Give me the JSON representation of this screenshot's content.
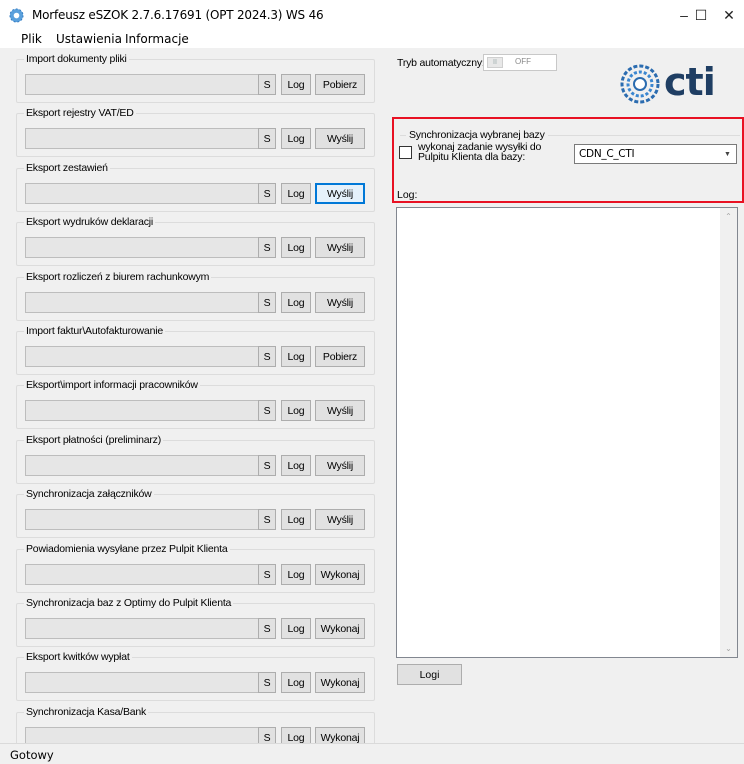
{
  "window": {
    "title": "Morfeusz eSZOK 2.7.6.17691 (OPT 2024.3) WS 46",
    "minimize_glyph": "–",
    "maximize_glyph": "☐",
    "close_glyph": "✕"
  },
  "menu": [
    "Plik",
    "Ustawienia",
    "Informacje"
  ],
  "groups": [
    {
      "title": "Import dokumenty pliki",
      "action": "Pobierz"
    },
    {
      "title": "Eksport rejestry VAT/ED",
      "action": "Wyślij"
    },
    {
      "title": "Eksport zestawień",
      "action": "Wyślij"
    },
    {
      "title": "Eksport wydruków deklaracji",
      "action": "Wyślij"
    },
    {
      "title": "Eksport rozliczeń z biurem rachunkowym",
      "action": "Wyślij"
    },
    {
      "title": "Import faktur\\Autofakturowanie",
      "action": "Pobierz"
    },
    {
      "title": "Eksport\\import informacji pracowników",
      "action": "Wyślij"
    },
    {
      "title": "Eksport płatności (preliminarz)",
      "action": "Wyślij"
    },
    {
      "title": "Synchronizacja załączników",
      "action": "Wyślij"
    },
    {
      "title": "Powiadomienia wysyłane przez Pulpit Klienta",
      "action": "Wykonaj"
    },
    {
      "title": "Synchronizacja baz z Optimy do Pulpit Klienta",
      "action": "Wykonaj"
    },
    {
      "title": "Eksport kwitków wypłat",
      "action": "Wykonaj"
    },
    {
      "title": "Synchronizacja Kasa/Bank",
      "action": "Wykonaj"
    }
  ],
  "buttons": {
    "s_label": "S",
    "log_label": "Log"
  },
  "auto_mode": {
    "label": "Tryb automatyczny:",
    "knob": "II",
    "state": "OFF"
  },
  "logo": {
    "text": "cti",
    "color": "#1f3e63",
    "accent": "#2b6cb0"
  },
  "sync": {
    "title": "Synchronizacja wybranej bazy",
    "checkbox_label": "wykonaj zadanie wysyłki do Pulpitu Klienta dla bazy:",
    "checked": false,
    "selected_db": "CDN_C_CTI",
    "highlight_color": "#e81123"
  },
  "log": {
    "label": "Log:",
    "content": ""
  },
  "logi_button": "Logi",
  "status": "Gotowy"
}
